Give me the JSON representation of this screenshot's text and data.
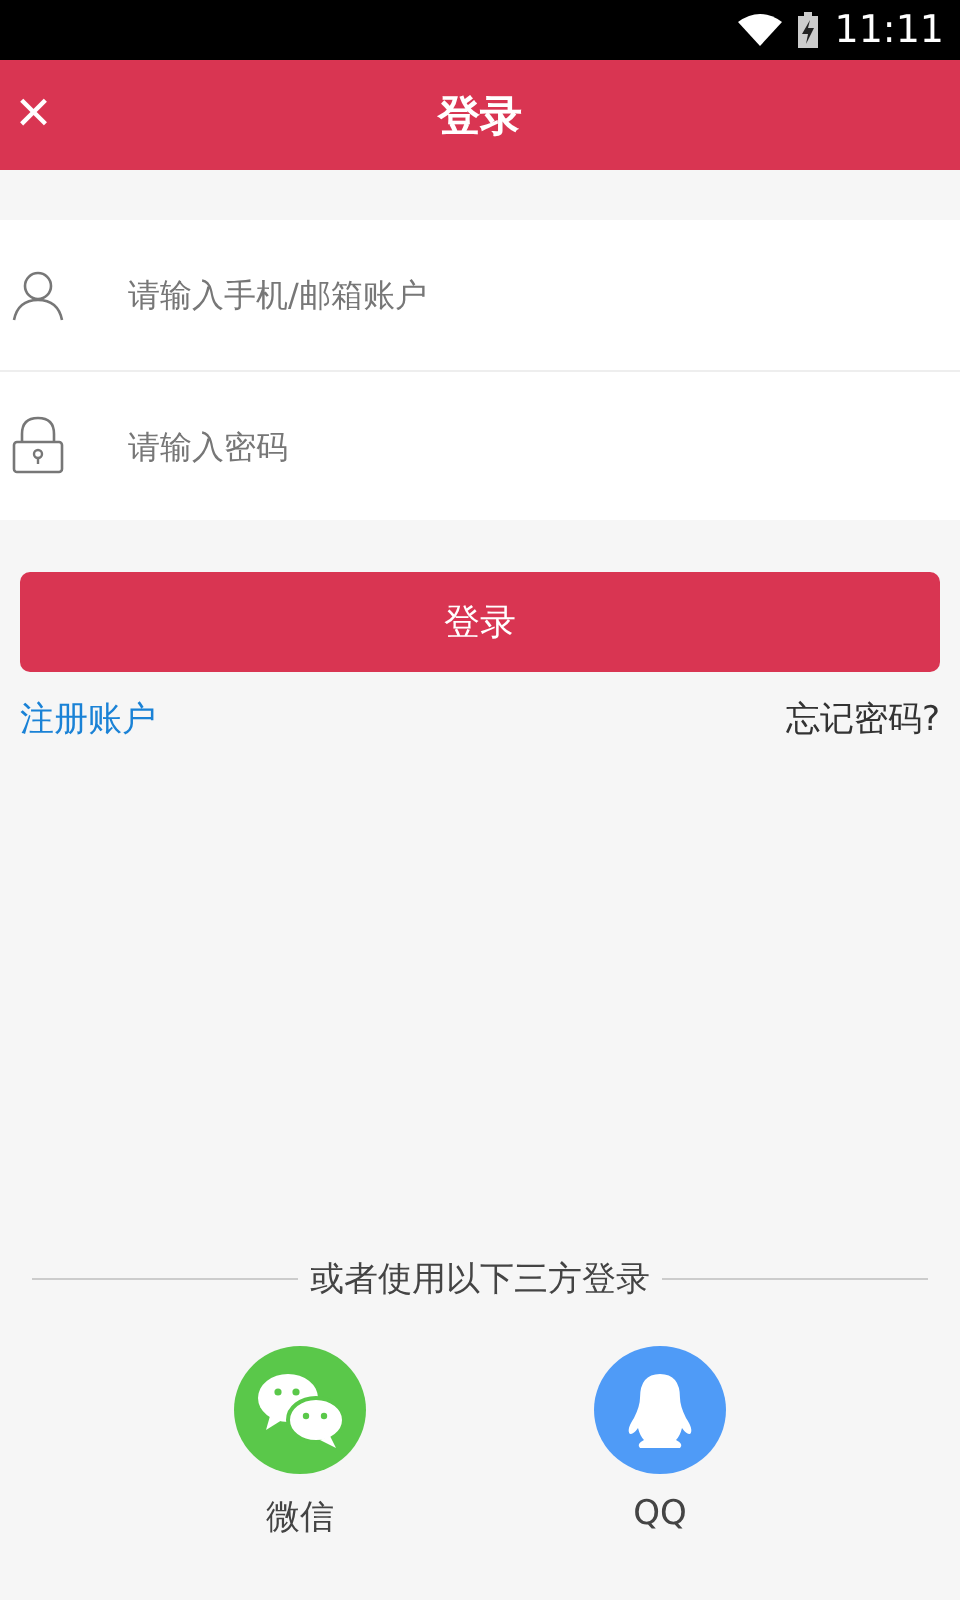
{
  "status_bar": {
    "time": "11:11"
  },
  "header": {
    "title": "登录",
    "close_label": "×"
  },
  "fields": [
    {
      "kind": "user",
      "placeholder": "请输入手机/邮箱账户"
    },
    {
      "kind": "lock",
      "placeholder": "请输入密码"
    }
  ],
  "login_button": "登录",
  "register_link": "注册账户",
  "forgot_link": "忘记密码?",
  "divider_text": "或者使用以下三方登录",
  "social_logins": [
    {
      "kind": "wechat",
      "label": "微信",
      "color": "#5ac84a"
    },
    {
      "kind": "qq",
      "label": "QQ",
      "color": "#4f9bf7"
    }
  ]
}
